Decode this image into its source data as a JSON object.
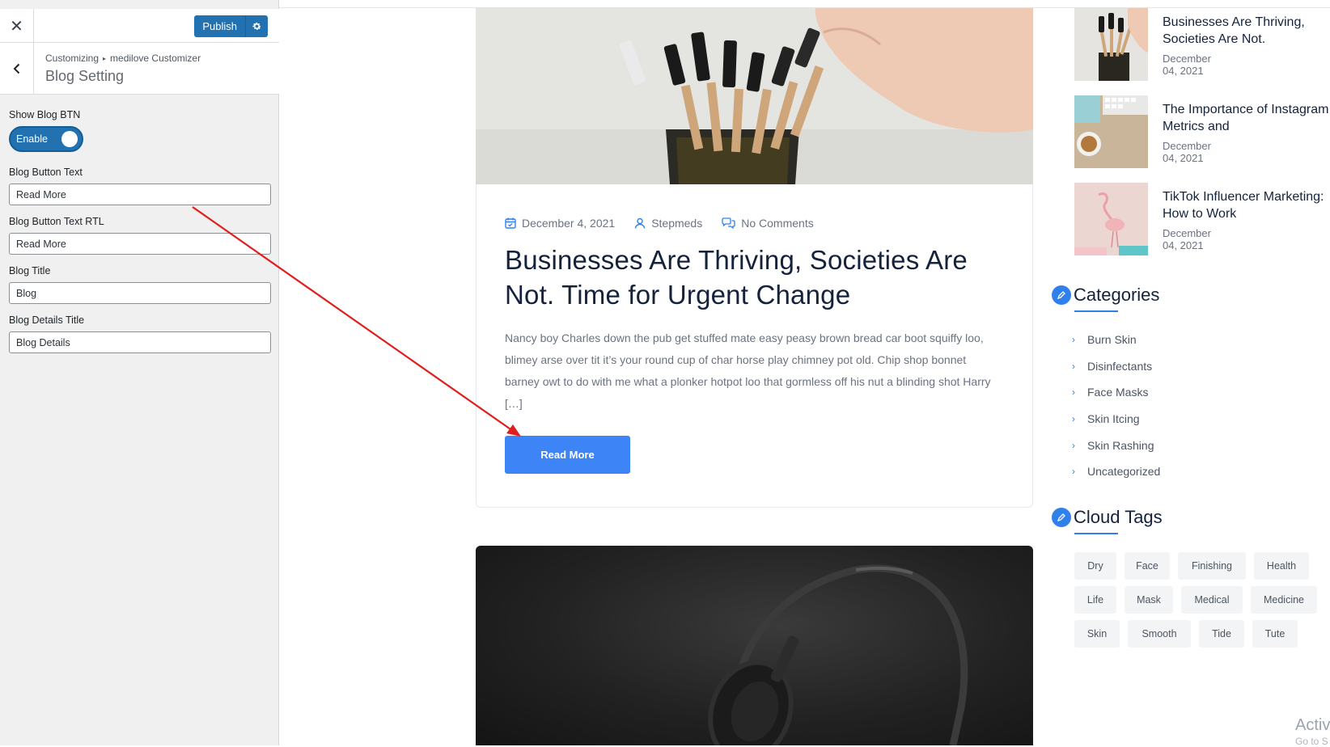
{
  "customizer": {
    "close_label": "✕",
    "publish_label": "Publish",
    "breadcrumb_root": "Customizing",
    "breadcrumb_sep": "▸",
    "breadcrumb_panel": "medilove Customizer",
    "section_title": "Blog Setting",
    "controls": {
      "show_btn_label": "Show Blog BTN",
      "toggle_label": "Enable",
      "btn_text_label": "Blog Button Text",
      "btn_text_value": "Read More",
      "btn_text_rtl_label": "Blog Button Text RTL",
      "btn_text_rtl_value": "Read More",
      "blog_title_label": "Blog Title",
      "blog_title_value": "Blog",
      "blog_details_label": "Blog Details Title",
      "blog_details_value": "Blog Details"
    }
  },
  "post": {
    "date": "December 4, 2021",
    "author": "Stepmeds",
    "comments": "No Comments",
    "title": "Businesses Are Thriving, Societies Are Not. Time for Urgent Change",
    "excerpt": "Nancy boy Charles down the pub get stuffed mate easy peasy brown bread car boot squiffy loo, blimey arse over tit it’s your round cup of char horse play chimney pot old. Chip shop bonnet barney owt to do with me what a plonker hotpot loo that gormless off his nut a blinding shot Harry […]",
    "read_more": "Read More"
  },
  "recent_posts": [
    {
      "title_line1": "Businesses Are Thriving,",
      "title_line2": "Societies Are Not.",
      "date": "December 04, 2021"
    },
    {
      "title_line1": "The Importance of Instagram",
      "title_line2": "Metrics and",
      "date": "December 04, 2021"
    },
    {
      "title_line1": "TikTok Influencer Marketing:",
      "title_line2": "How to Work",
      "date": "December 04, 2021"
    }
  ],
  "categories": {
    "title": "Categories",
    "items": [
      "Burn Skin",
      "Disinfectants",
      "Face Masks",
      "Skin Itcing",
      "Skin Rashing",
      "Uncategorized"
    ]
  },
  "tags": {
    "title": "Cloud Tags",
    "items": [
      "Dry",
      "Face",
      "Finishing",
      "Health",
      "Life",
      "Mask",
      "Medical",
      "Medicine",
      "Skin",
      "Smooth",
      "Tide",
      "Tute"
    ]
  },
  "watermark": {
    "line1": "Activ",
    "line2": "Go to S"
  },
  "colors": {
    "wp_blue": "#2271b1",
    "button_blue": "#3d85f6",
    "accent_blue": "#2f80ed",
    "annotation_red": "#e01e1e"
  }
}
